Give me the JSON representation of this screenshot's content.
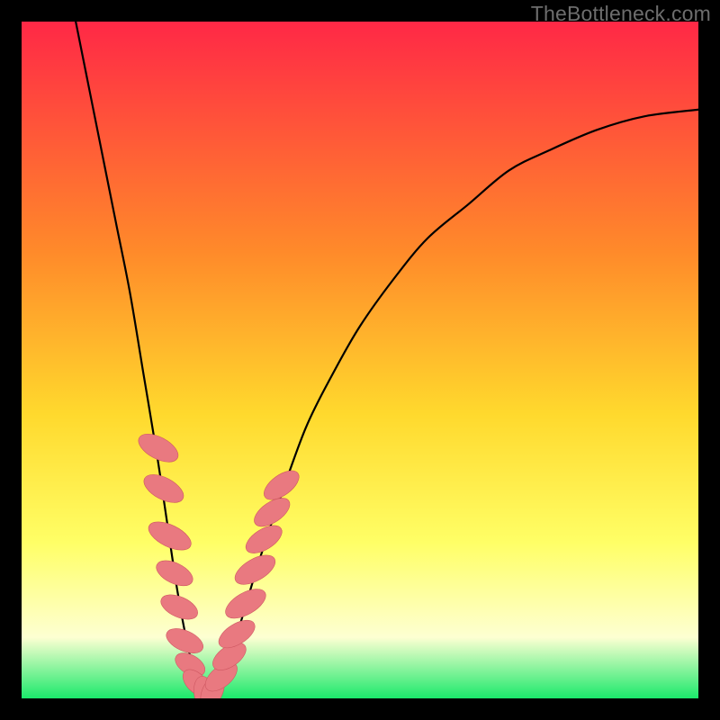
{
  "watermark": "TheBottleneck.com",
  "colors": {
    "frame": "#000000",
    "watermark": "#6d6d6d",
    "curve": "#000000",
    "marker_fill": "#e97980",
    "marker_stroke": "#cf5861",
    "grad_top": "#ff2846",
    "grad_mid1": "#ff8a2a",
    "grad_mid2": "#ffd92d",
    "grad_mid3": "#ffff66",
    "grad_mid4": "#fdffd2",
    "grad_bottom": "#1be96b"
  },
  "chart_data": {
    "type": "line",
    "title": "",
    "xlabel": "",
    "ylabel": "",
    "xlim": [
      0,
      100
    ],
    "ylim": [
      0,
      100
    ],
    "series": [
      {
        "name": "curve",
        "x": [
          8,
          10,
          12,
          14,
          16,
          18,
          20,
          21.5,
          23,
          24.5,
          26,
          27,
          28,
          30,
          32,
          35,
          38,
          42,
          46,
          50,
          55,
          60,
          66,
          72,
          78,
          85,
          92,
          100
        ],
        "y": [
          100,
          90,
          80,
          70,
          60,
          48,
          36,
          26,
          16,
          8,
          2,
          0,
          0.5,
          4,
          10,
          20,
          29,
          40,
          48,
          55,
          62,
          68,
          73,
          78,
          81,
          84,
          86,
          87
        ]
      }
    ],
    "markers": [
      {
        "x": 20.2,
        "y": 37,
        "rx": 1.6,
        "ry": 3.2,
        "rot": -62
      },
      {
        "x": 21.0,
        "y": 31,
        "rx": 1.6,
        "ry": 3.2,
        "rot": -62
      },
      {
        "x": 21.9,
        "y": 24,
        "rx": 1.6,
        "ry": 3.4,
        "rot": -64
      },
      {
        "x": 22.6,
        "y": 18.5,
        "rx": 1.5,
        "ry": 2.9,
        "rot": -64
      },
      {
        "x": 23.3,
        "y": 13.5,
        "rx": 1.5,
        "ry": 2.9,
        "rot": -66
      },
      {
        "x": 24.1,
        "y": 8.5,
        "rx": 1.5,
        "ry": 2.9,
        "rot": -66
      },
      {
        "x": 24.9,
        "y": 5,
        "rx": 1.4,
        "ry": 2.4,
        "rot": -60
      },
      {
        "x": 25.8,
        "y": 2.3,
        "rx": 1.4,
        "ry": 2.4,
        "rot": -45
      },
      {
        "x": 27.0,
        "y": 0.7,
        "rx": 1.5,
        "ry": 2.6,
        "rot": -10
      },
      {
        "x": 28.2,
        "y": 1,
        "rx": 1.5,
        "ry": 2.6,
        "rot": 25
      },
      {
        "x": 29.5,
        "y": 3.2,
        "rx": 1.5,
        "ry": 2.8,
        "rot": 50
      },
      {
        "x": 30.7,
        "y": 6.2,
        "rx": 1.5,
        "ry": 2.8,
        "rot": 55
      },
      {
        "x": 31.8,
        "y": 9.5,
        "rx": 1.5,
        "ry": 3.0,
        "rot": 58
      },
      {
        "x": 33.1,
        "y": 14,
        "rx": 1.6,
        "ry": 3.3,
        "rot": 60
      },
      {
        "x": 34.5,
        "y": 19,
        "rx": 1.6,
        "ry": 3.3,
        "rot": 60
      },
      {
        "x": 35.8,
        "y": 23.5,
        "rx": 1.5,
        "ry": 3.0,
        "rot": 58
      },
      {
        "x": 37.0,
        "y": 27.5,
        "rx": 1.5,
        "ry": 3.0,
        "rot": 56
      },
      {
        "x": 38.4,
        "y": 31.5,
        "rx": 1.5,
        "ry": 3.0,
        "rot": 54
      }
    ]
  }
}
